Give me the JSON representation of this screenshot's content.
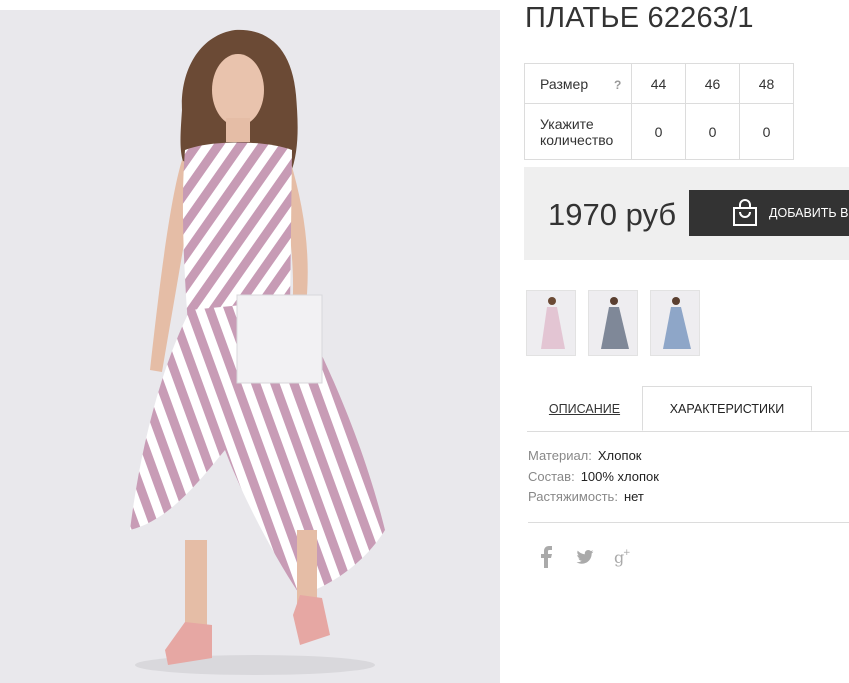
{
  "product": {
    "title": "ПЛАТЬЕ 62263/1"
  },
  "size_table": {
    "size_label": "Размер",
    "help_label": "?",
    "sizes": [
      "44",
      "46",
      "48"
    ],
    "qty_label_line1": "Укажите",
    "qty_label_line2": "количество",
    "quantities": [
      "0",
      "0",
      "0"
    ]
  },
  "buy": {
    "price": "1970 руб",
    "button_label": "ДОБАВИТЬ В"
  },
  "tabs": {
    "description": "ОПИСАНИЕ",
    "characteristics": "ХАРАКТЕРИСТИКИ"
  },
  "specs": [
    {
      "key": "Материал:",
      "value": "Хлопок"
    },
    {
      "key": "Состав:",
      "value": "100% хлопок"
    },
    {
      "key": "Растяжимость:",
      "value": "нет"
    }
  ],
  "social": {
    "facebook": "f",
    "google": "g+"
  },
  "colors": {
    "dark": "#333333",
    "pink_stripe": "#c79bb5",
    "blue_stripe": "#8ea6c8",
    "grey_dress": "#7f8898"
  }
}
